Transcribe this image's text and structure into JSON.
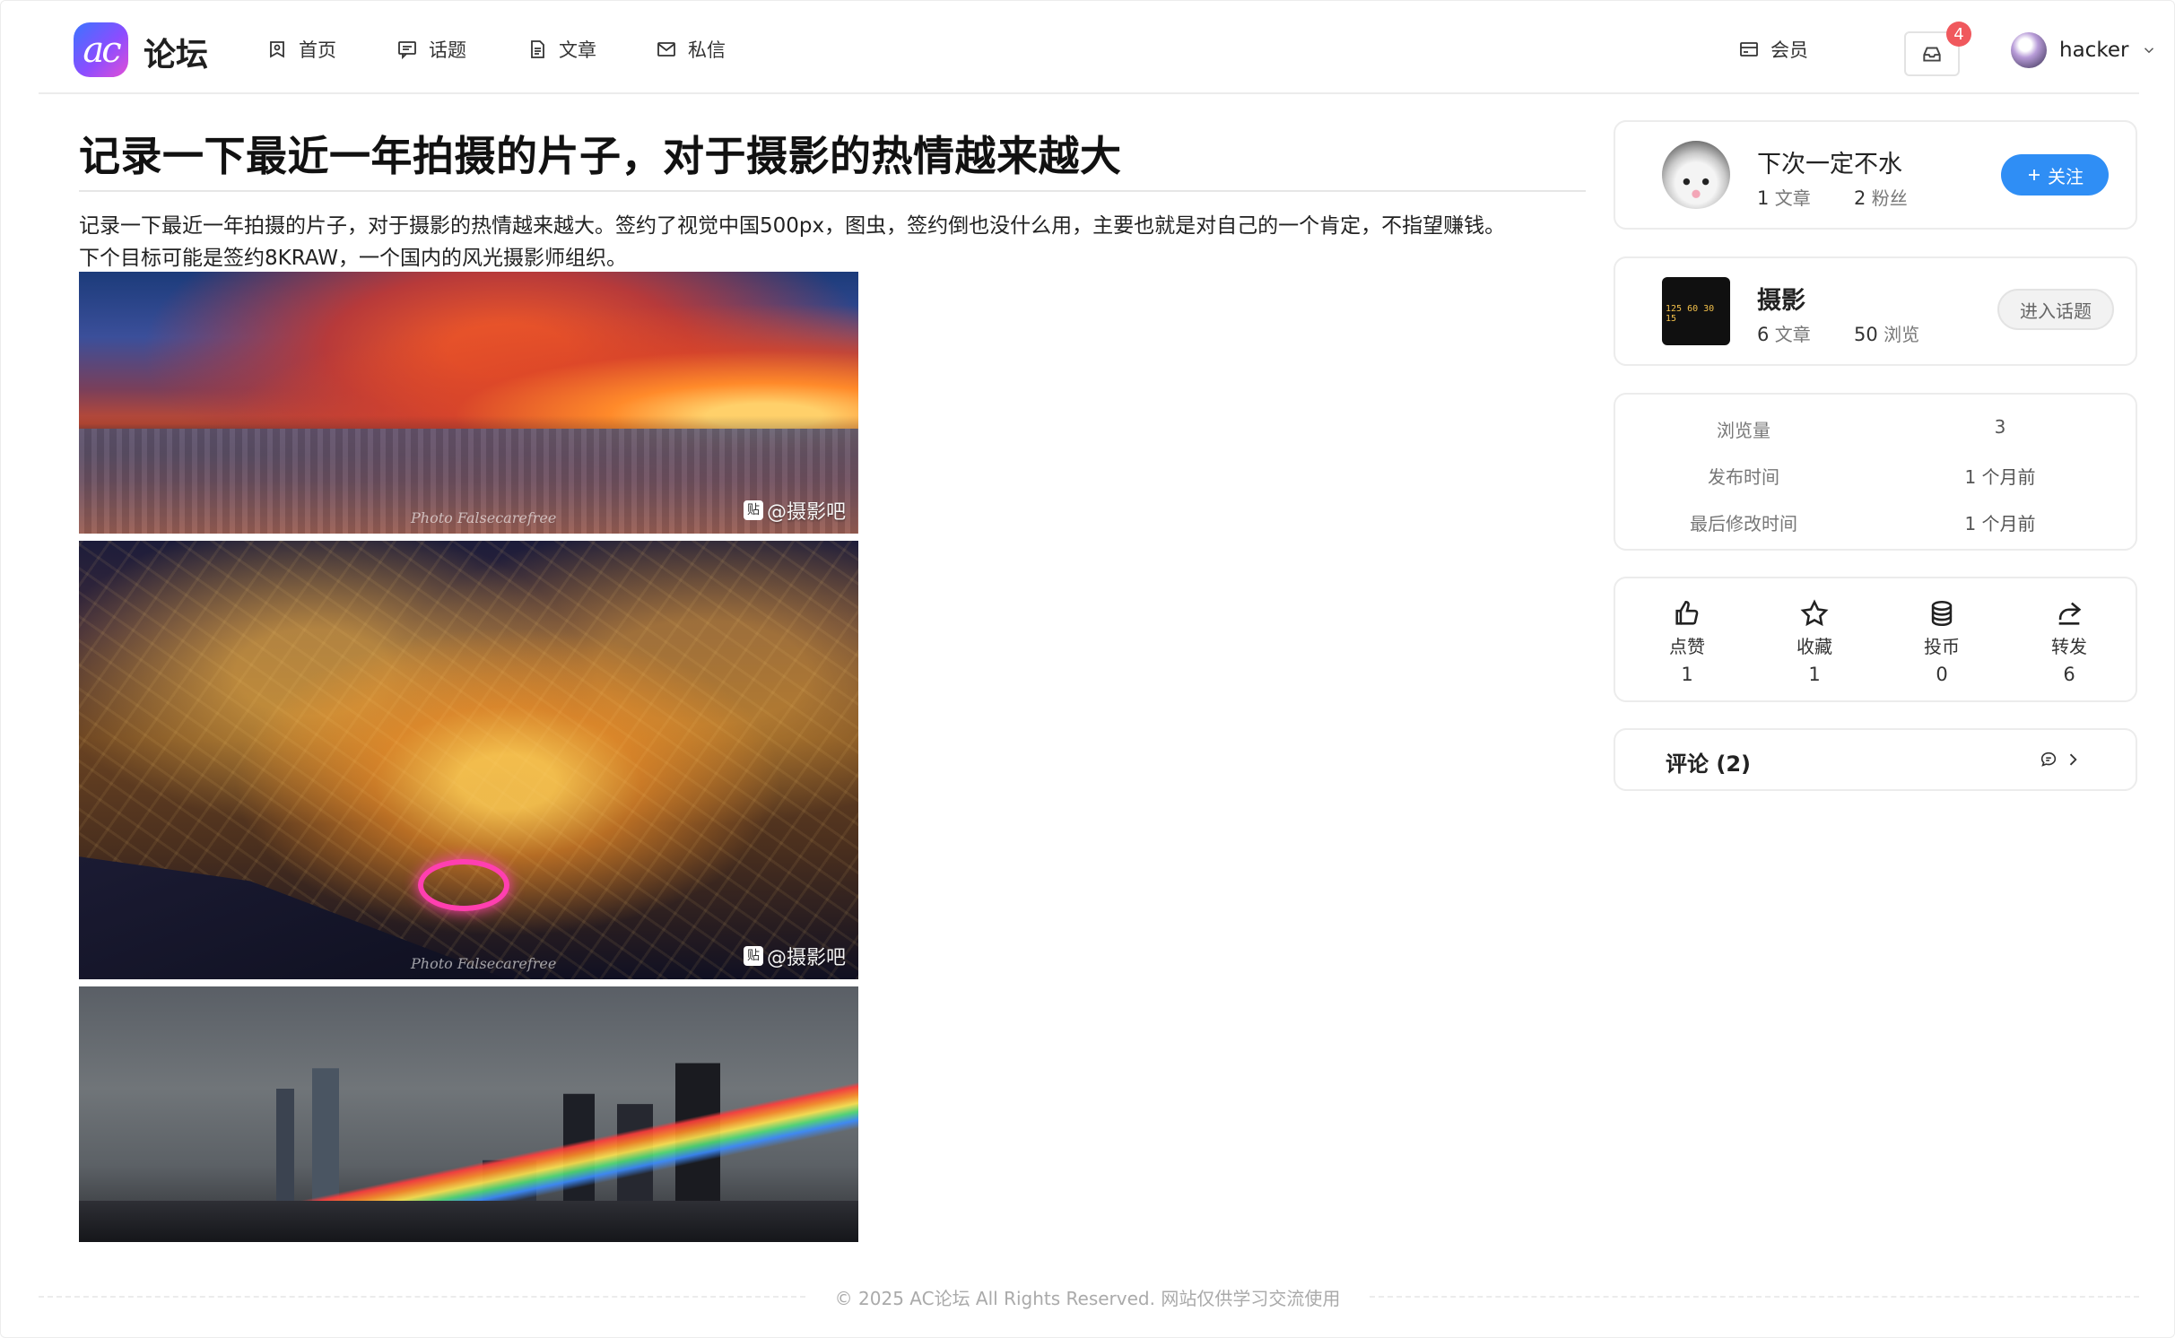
{
  "brand": {
    "logo_text": "ac",
    "name": "论坛"
  },
  "nav": [
    {
      "label": "首页",
      "icon": "home-icon"
    },
    {
      "label": "话题",
      "icon": "chat-square-icon"
    },
    {
      "label": "文章",
      "icon": "document-icon"
    },
    {
      "label": "私信",
      "icon": "mail-icon"
    }
  ],
  "header_right": {
    "vip_label": "会员",
    "inbox_badge": "4",
    "username": "hacker"
  },
  "article": {
    "title": "记录一下最近一年拍摄的片子，对于摄影的热情越来越大",
    "body_line1": "记录一下最近一年拍摄的片子，对于摄影的热情越来越大。签约了视觉中国500px，图虫，签约倒也没什么用，主要也就是对自己的一个肯定，不指望赚钱。",
    "body_line2": "下个目标可能是签约8KRAW，一个国内的风光摄影师组织。",
    "watermark": "@摄影吧",
    "watermark_badge": "贴",
    "signature": "Photo Falsecarefree"
  },
  "author": {
    "name": "下次一定不水",
    "articles_count": "1",
    "articles_label": "文章",
    "fans_count": "2",
    "fans_label": "粉丝",
    "follow_label": "关注"
  },
  "topic": {
    "name": "摄影",
    "thumb_text": "125 60 30 15",
    "articles_count": "6",
    "articles_label": "文章",
    "views_count": "50",
    "views_label": "浏览",
    "enter_label": "进入话题"
  },
  "stats": [
    {
      "key": "浏览量",
      "value": "3"
    },
    {
      "key": "发布时间",
      "value": "1 个月前"
    },
    {
      "key": "最后修改时间",
      "value": "1 个月前"
    }
  ],
  "actions": [
    {
      "label": "点赞",
      "count": "1",
      "icon": "thumb-up-icon"
    },
    {
      "label": "收藏",
      "count": "1",
      "icon": "star-icon"
    },
    {
      "label": "投币",
      "count": "0",
      "icon": "coin-stack-icon"
    },
    {
      "label": "转发",
      "count": "6",
      "icon": "share-icon"
    }
  ],
  "comments": {
    "label": "评论 (2)"
  },
  "footer": {
    "text": "© 2025 AC论坛 All Rights Reserved. 网站仅供学习交流使用"
  },
  "colors": {
    "accent": "#2f8ef5",
    "badge": "#f0585d",
    "border": "#ececec"
  }
}
